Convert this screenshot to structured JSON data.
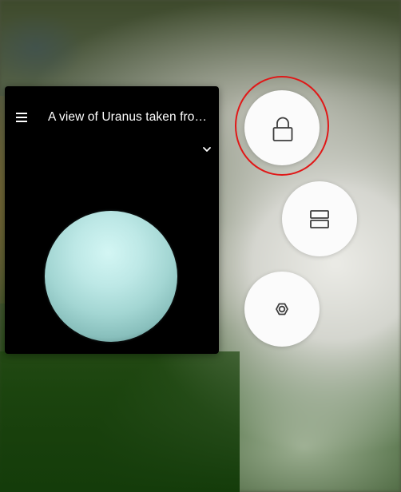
{
  "app_window": {
    "title": "A view of Uranus taken from...",
    "image_subject": "Uranus"
  },
  "icons": {
    "menu": "hamburger-menu-icon",
    "expand": "chevron-down-icon",
    "lock": "lock-icon",
    "split": "split-screen-icon",
    "settings": "hexagon-settings-icon"
  },
  "colors": {
    "app_background": "#000000",
    "button_background": "#fbfbfb",
    "icon_stroke": "#3c3c3c",
    "highlight": "#e01818"
  }
}
